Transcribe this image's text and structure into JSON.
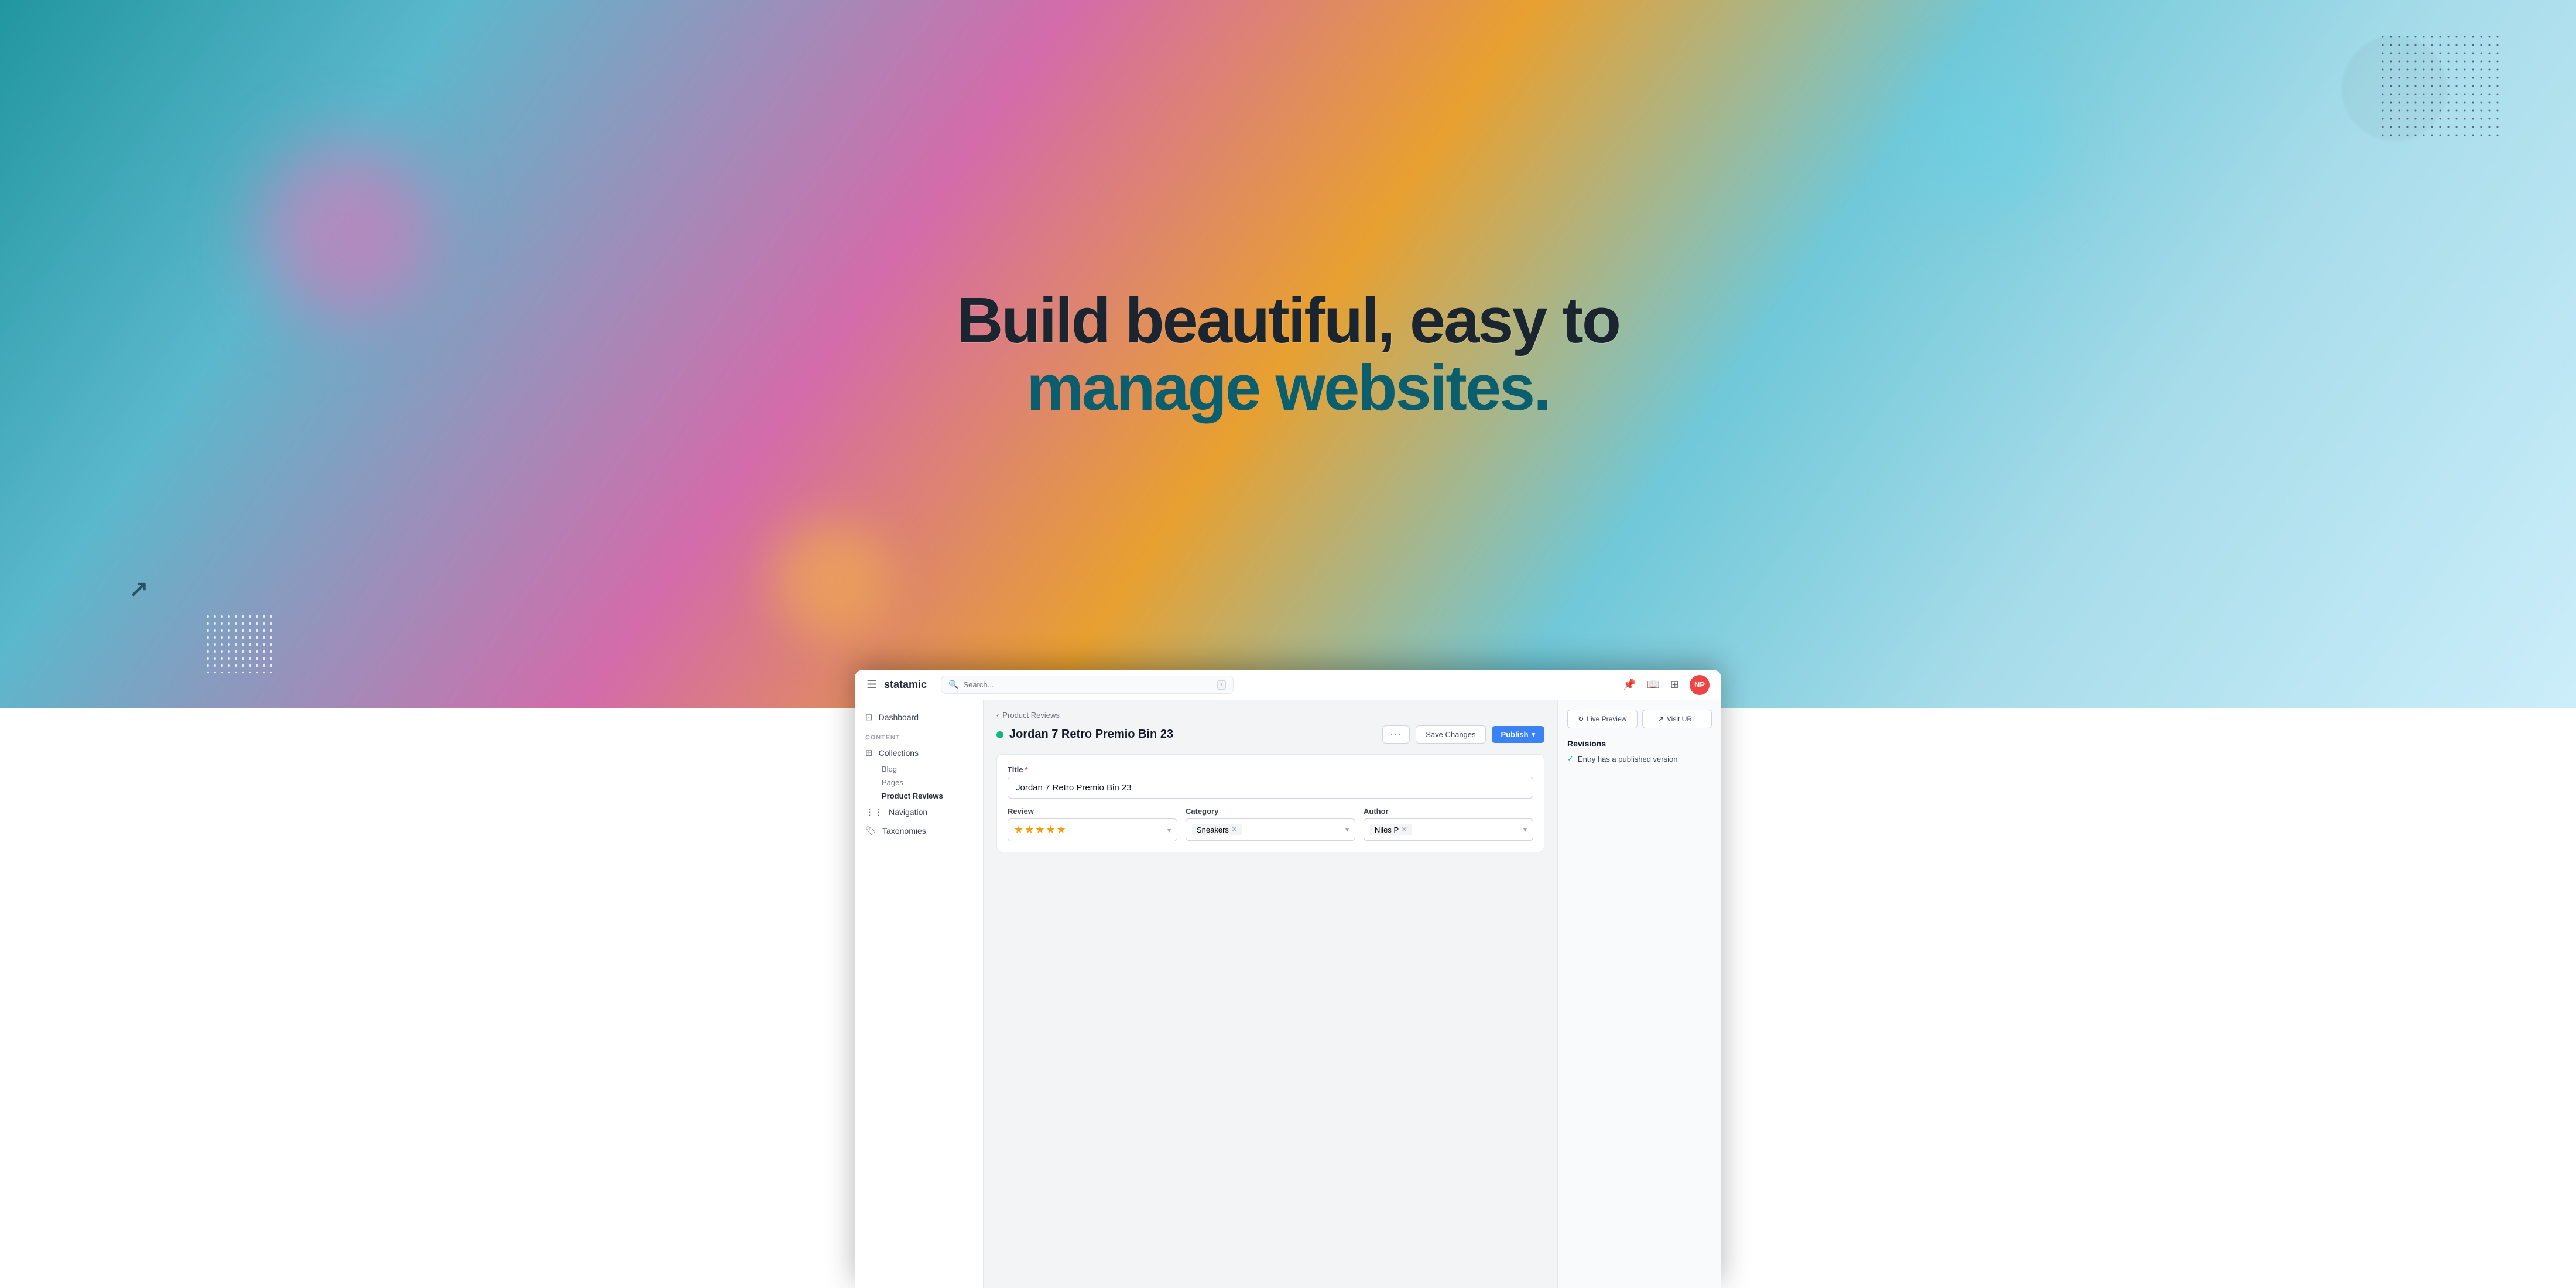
{
  "hero": {
    "line1": "Build beautiful, easy to",
    "line2": "manage websites."
  },
  "topbar": {
    "brand": "statamic",
    "search_placeholder": "Search...",
    "search_kbd": "/",
    "avatar_initials": "NP"
  },
  "sidebar": {
    "dashboard_label": "Dashboard",
    "content_section": "CONTENT",
    "collections_label": "Collections",
    "blog_label": "Blog",
    "pages_label": "Pages",
    "product_reviews_label": "Product Reviews",
    "navigation_label": "Navigation",
    "taxonomies_label": "Taxonomies"
  },
  "breadcrumb": {
    "parent": "Product Reviews"
  },
  "entry": {
    "title": "Jordan 7 Retro Premio Bin 23",
    "status": "published"
  },
  "actions": {
    "more": "···",
    "save_changes": "Save Changes",
    "publish": "Publish",
    "publish_arrow": "▾"
  },
  "form": {
    "title_label": "Title",
    "title_required": "*",
    "title_value": "Jordan 7 Retro Premio Bin 23",
    "review_label": "Review",
    "category_label": "Category",
    "author_label": "Author",
    "category_value": "Sneakers",
    "author_value": "Niles P",
    "stars": "★★★★★"
  },
  "right_panel": {
    "live_preview_label": "Live Preview",
    "visit_url_label": "Visit URL",
    "revisions_heading": "Revisions",
    "revision_item": "Entry has a published version"
  }
}
